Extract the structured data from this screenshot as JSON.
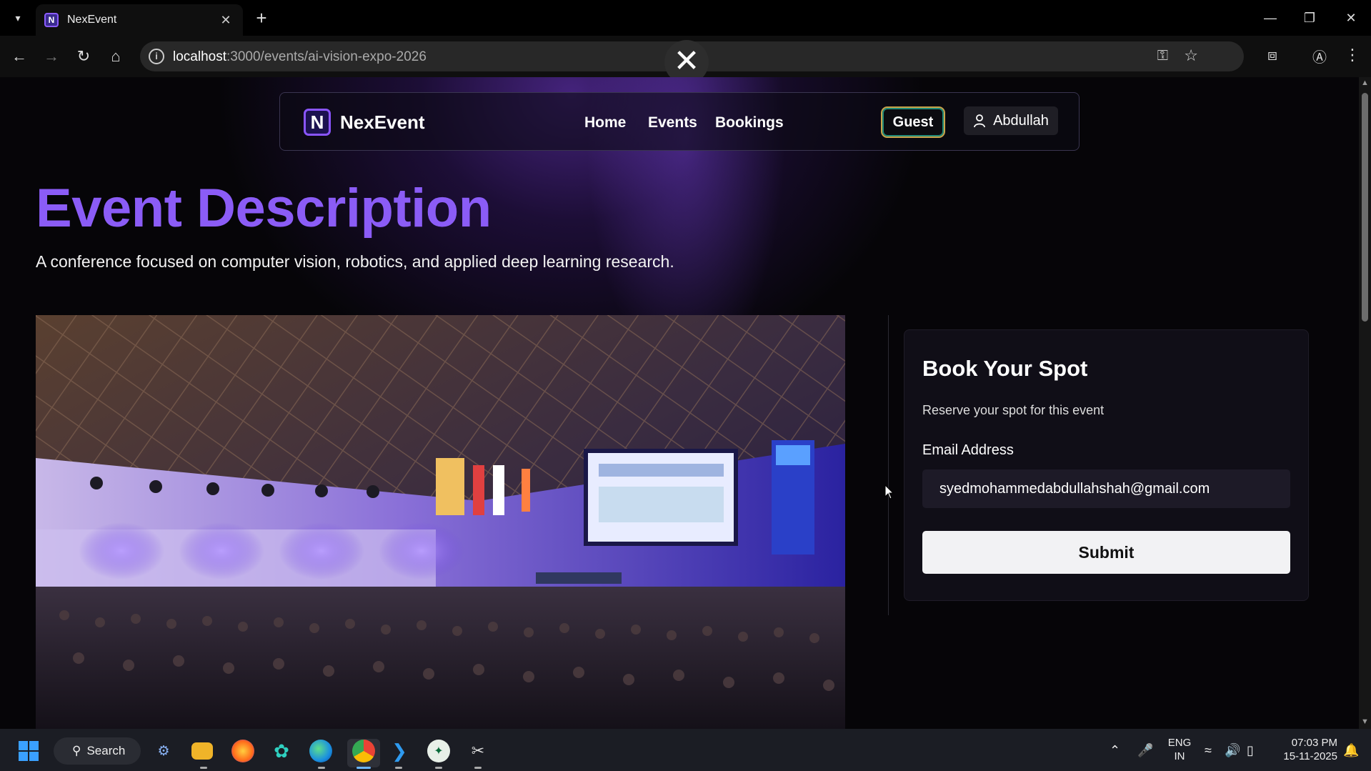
{
  "browser": {
    "tab_title": "NexEvent",
    "tab_favicon": "N",
    "url_host": "localhost",
    "url_path": ":3000/events/ai-vision-expo-2026"
  },
  "navbar": {
    "brand_letter": "N",
    "brand_name": "NexEvent",
    "links": [
      "Home",
      "Events",
      "Bookings"
    ],
    "guest_label": "Guest",
    "user_label": "Abdullah"
  },
  "main": {
    "heading": "Event Description",
    "description": "A conference focused on computer vision, robotics, and applied deep learning research."
  },
  "booking": {
    "title": "Book Your Spot",
    "subtitle": "Reserve your spot for this event",
    "email_label": "Email Address",
    "email_value": "syedmohammedabdullahshah@gmail.com",
    "submit_label": "Submit"
  },
  "taskbar": {
    "search_label": "Search",
    "language_line1": "ENG",
    "language_line2": "IN",
    "time": "07:03 PM",
    "date": "15-11-2025"
  },
  "colors": {
    "accent": "#8b5cf6",
    "background": "#060508",
    "card": "#100e17"
  }
}
